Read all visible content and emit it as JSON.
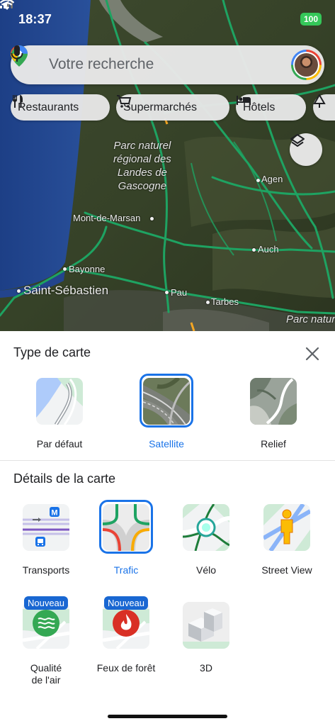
{
  "status": {
    "time": "18:37",
    "battery": "100"
  },
  "search": {
    "placeholder": "Votre recherche"
  },
  "chips": [
    {
      "label": "Restaurants",
      "icon": "restaurant-icon"
    },
    {
      "label": "Supermarchés",
      "icon": "cart-icon"
    },
    {
      "label": "Hôtels",
      "icon": "bed-icon"
    }
  ],
  "map_labels": {
    "park": "Parc naturel\nrégional des\nLandes de\nGascogne",
    "agen": "Agen",
    "mont_de_marsan": "Mont-de-Marsan",
    "auch": "Auch",
    "bayonne": "Bayonne",
    "saint_sebastien": "Saint-Sébastien",
    "pau": "Pau",
    "tarbes": "Tarbes",
    "parc": "Parc natur"
  },
  "sheet": {
    "map_type_title": "Type de carte",
    "map_types": [
      {
        "label": "Par défaut",
        "selected": false
      },
      {
        "label": "Satellite",
        "selected": true
      },
      {
        "label": "Relief",
        "selected": false
      }
    ],
    "details_title": "Détails de la carte",
    "details": [
      {
        "label": "Transports",
        "selected": false
      },
      {
        "label": "Trafic",
        "selected": true
      },
      {
        "label": "Vélo",
        "selected": false
      },
      {
        "label": "Street View",
        "selected": false
      },
      {
        "label": "Qualité\nde l'air",
        "badge": "Nouveau",
        "selected": false
      },
      {
        "label": "Feux de forêt",
        "badge": "Nouveau",
        "selected": false
      },
      {
        "label": "3D",
        "selected": false
      }
    ]
  },
  "colors": {
    "accent": "#1a73e8",
    "traffic_green": "#1ea362",
    "battery": "#35c759"
  }
}
